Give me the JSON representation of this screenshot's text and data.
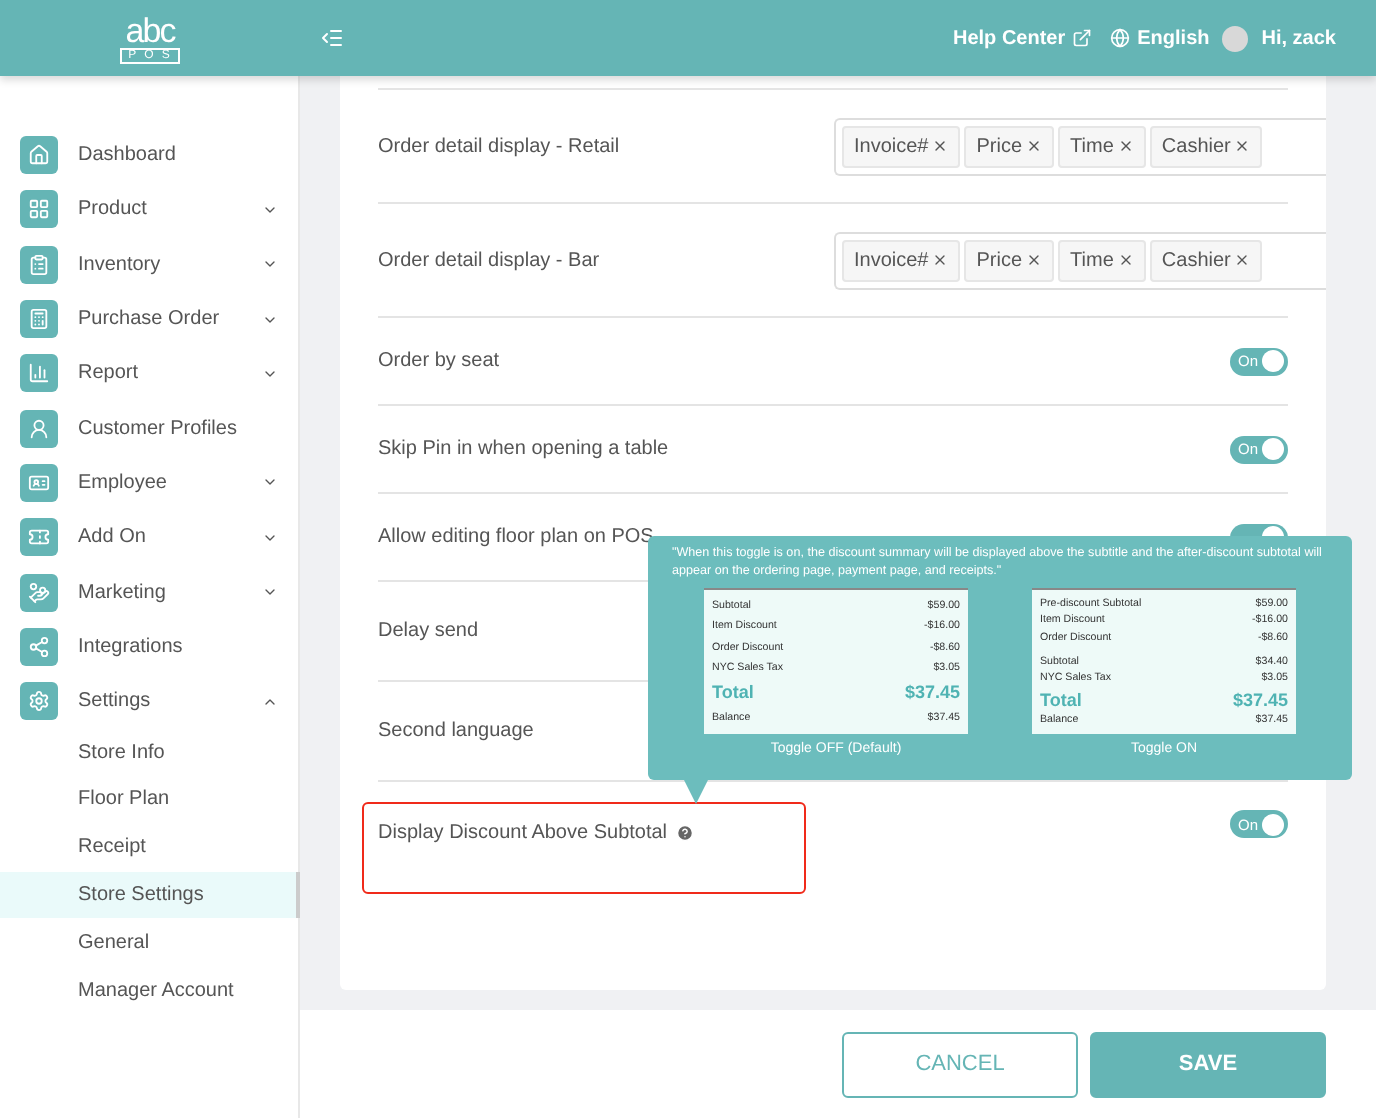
{
  "header": {
    "logo_top": "abc",
    "logo_bottom": "POS",
    "help": "Help Center",
    "language": "English",
    "greeting": "Hi, zack"
  },
  "sidebar": {
    "items": [
      {
        "label": "Dashboard"
      },
      {
        "label": "Product",
        "expanded": false
      },
      {
        "label": "Inventory",
        "expanded": false
      },
      {
        "label": "Purchase Order",
        "expanded": false
      },
      {
        "label": "Report",
        "expanded": false
      },
      {
        "label": "Customer Profiles"
      },
      {
        "label": "Employee",
        "expanded": false
      },
      {
        "label": "Add On",
        "expanded": false
      },
      {
        "label": "Marketing",
        "expanded": false
      },
      {
        "label": "Integrations"
      },
      {
        "label": "Settings",
        "expanded": true,
        "children": [
          {
            "label": "Store Info",
            "selected": false
          },
          {
            "label": "Floor Plan",
            "selected": false
          },
          {
            "label": "Receipt",
            "selected": false
          },
          {
            "label": "Store Settings",
            "selected": true
          },
          {
            "label": "General",
            "selected": false
          },
          {
            "label": "Manager Account",
            "selected": false
          }
        ]
      }
    ]
  },
  "settings": [
    {
      "kind": "tags",
      "label": "Order detail display - Retail",
      "tags": [
        "Invoice#",
        "Price",
        "Time",
        "Cashier"
      ]
    },
    {
      "kind": "tags",
      "label": "Order detail display - Bar",
      "tags": [
        "Invoice#",
        "Price",
        "Time",
        "Cashier"
      ]
    },
    {
      "kind": "toggle",
      "label": "Order by seat",
      "on": true,
      "toggle_text": "On"
    },
    {
      "kind": "toggle",
      "label": "Skip Pin in when opening a table",
      "on": true,
      "toggle_text": "On"
    },
    {
      "kind": "toggle",
      "label": "Allow editing floor plan on POS",
      "on": true
    },
    {
      "kind": "plain",
      "label": "Delay send"
    },
    {
      "kind": "plain",
      "label": "Second language"
    },
    {
      "kind": "toggle",
      "label": "Display Discount Above Subtotal",
      "on": true,
      "toggle_text": "On",
      "help": true,
      "highlighted": true
    }
  ],
  "tooltip": {
    "text": "\"When this toggle is on, the discount summary will be displayed above the subtitle and the after-discount subtotal will appear on the ordering page, payment page, and receipts.\"",
    "examples": [
      {
        "caption": "Toggle OFF (Default)",
        "lines": [
          {
            "kind": "line",
            "label": "Subtotal",
            "value": "$59.00"
          },
          {
            "kind": "line",
            "label": "Item Discount",
            "value": "-$16.00"
          },
          {
            "kind": "line",
            "label": "Order Discount",
            "value": "-$8.60"
          },
          {
            "kind": "line",
            "label": "NYC Sales Tax",
            "value": "$3.05"
          },
          {
            "kind": "total",
            "label": "Total",
            "value": "$37.45"
          },
          {
            "kind": "line",
            "label": "Balance",
            "value": "$37.45"
          }
        ]
      },
      {
        "caption": "Toggle ON",
        "lines": [
          {
            "kind": "line",
            "label": "Pre-discount Subtotal",
            "value": "$59.00"
          },
          {
            "kind": "line",
            "label": "Item Discount",
            "value": "-$16.00"
          },
          {
            "kind": "line",
            "label": "Order Discount",
            "value": "-$8.60"
          },
          {
            "kind": "gap"
          },
          {
            "kind": "line",
            "label": "Subtotal",
            "value": "$34.40"
          },
          {
            "kind": "line",
            "label": "NYC Sales Tax",
            "value": "$3.05"
          },
          {
            "kind": "total",
            "label": "Total",
            "value": "$37.45"
          },
          {
            "kind": "line",
            "label": "Balance",
            "value": "$37.45"
          }
        ]
      }
    ]
  },
  "footer": {
    "cancel": "CANCEL",
    "save": "SAVE"
  }
}
